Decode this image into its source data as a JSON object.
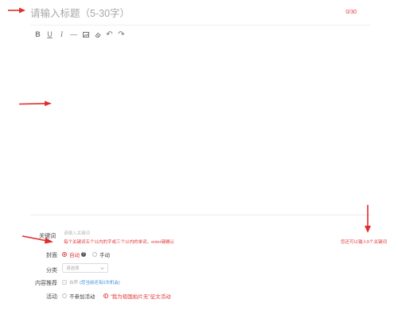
{
  "title": {
    "placeholder": "请输入标题（5-30字）",
    "value": "",
    "counter": "0/30"
  },
  "toolbar": {
    "items": [
      {
        "name": "bold",
        "glyph": "B"
      },
      {
        "name": "underline",
        "glyph": "U"
      },
      {
        "name": "italic",
        "glyph": "I"
      },
      {
        "name": "horizontal-rule",
        "glyph": "—"
      },
      {
        "name": "image",
        "glyph": ""
      },
      {
        "name": "clear-format",
        "glyph": ""
      },
      {
        "name": "undo",
        "glyph": "↶"
      },
      {
        "name": "redo",
        "glyph": "↷"
      }
    ]
  },
  "editor": {
    "content": ""
  },
  "keywords": {
    "label": "关键词",
    "placeholder": "请输入关键词",
    "hint": "每个关键词五个以内的字或三个以内的单词，enter键确认",
    "limit_hint": "您还可以输入5个关键词"
  },
  "cover": {
    "label": "封面",
    "options": [
      {
        "label": "自动",
        "selected": true
      },
      {
        "label": "手动",
        "selected": false
      }
    ]
  },
  "category": {
    "label": "分类",
    "placeholder": "请选择"
  },
  "recommend": {
    "label": "内容推荐",
    "text": "自荐",
    "link": "(您当前还有0次机会)"
  },
  "activity": {
    "label": "活动",
    "options": [
      {
        "label": "不参加活动",
        "selected": false
      },
      {
        "label": "\"我为祖国拍片无\"征文活动",
        "selected": true
      }
    ]
  },
  "colors": {
    "accent": "#e4393c",
    "link": "#3f8fdc",
    "annotation": "#e32b2b"
  }
}
